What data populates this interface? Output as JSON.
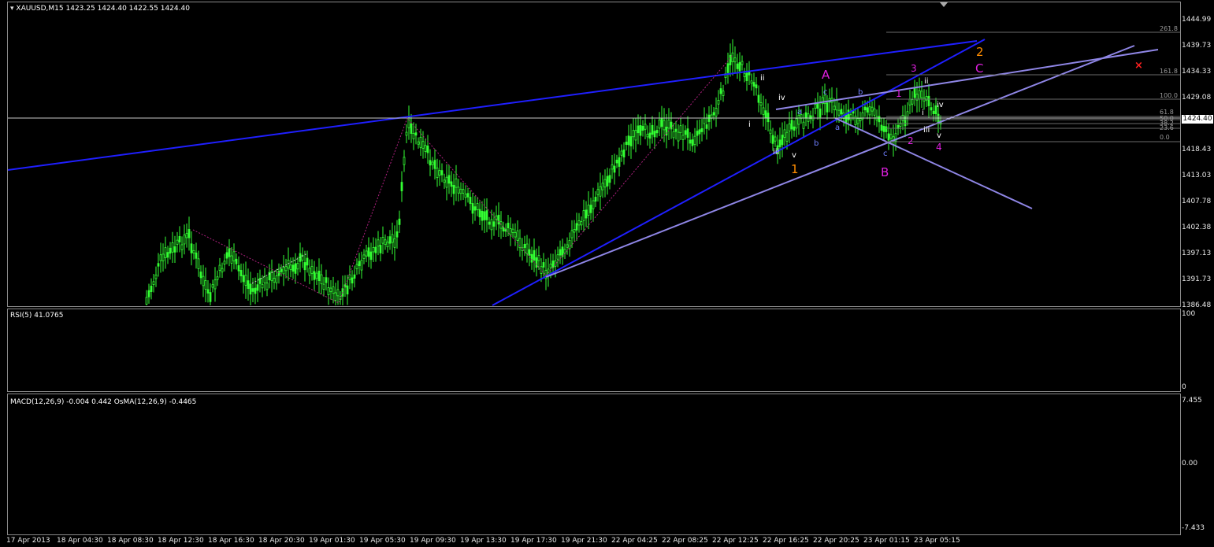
{
  "header": {
    "symbol": "XAUUSD,M15",
    "ohlc": "1423.25 1424.40 1422.55 1424.40"
  },
  "price_axis": {
    "ticks": [
      "1444.99",
      "1439.73",
      "1434.33",
      "1429.08",
      "1423.68",
      "1418.43",
      "1413.03",
      "1407.78",
      "1402.38",
      "1397.13",
      "1391.73",
      "1386.48"
    ],
    "current_price": "1424.40"
  },
  "rsi": {
    "label": "RSI(5) 41.0765",
    "ticks": [
      "100",
      "0"
    ]
  },
  "macd": {
    "label": "MACD(12,26,9) -0.004 0.442  OsMA(12,26,9) -0.4465",
    "ticks": [
      "7.455",
      "0.00",
      "-7.433"
    ]
  },
  "time_axis": [
    "17 Apr 2013",
    "18 Apr 04:30",
    "18 Apr 08:30",
    "18 Apr 12:30",
    "18 Apr 16:30",
    "18 Apr 20:30",
    "19 Apr 01:30",
    "19 Apr 05:30",
    "19 Apr 09:30",
    "19 Apr 13:30",
    "19 Apr 17:30",
    "19 Apr 21:30",
    "22 Apr 04:25",
    "22 Apr 08:25",
    "22 Apr 12:25",
    "22 Apr 16:25",
    "22 Apr 20:25",
    "23 Apr 01:15",
    "23 Apr 05:15"
  ],
  "fib_levels": [
    "261.8",
    "161.8",
    "100.0",
    "61.8",
    "50.0",
    "38.2",
    "23.6",
    "0.0"
  ],
  "wave_labels": [
    {
      "text": "A",
      "color": "#e020e0"
    },
    {
      "text": "B",
      "color": "#e020e0"
    },
    {
      "text": "C",
      "color": "#e020e0"
    },
    {
      "text": "1",
      "color": "#ff8c00"
    },
    {
      "text": "2",
      "color": "#ff8c00"
    },
    {
      "text": "3",
      "color": "#e020e0"
    },
    {
      "text": "4",
      "color": "#e020e0"
    },
    {
      "text": "2",
      "color": "#e020e0"
    },
    {
      "text": "1",
      "color": "#e020e0"
    },
    {
      "text": "ii",
      "color": "#ffffff"
    },
    {
      "text": "i",
      "color": "#ffffff"
    },
    {
      "text": "iii",
      "color": "#ffffff"
    },
    {
      "text": "iv",
      "color": "#ffffff"
    },
    {
      "text": "v",
      "color": "#ffffff"
    },
    {
      "text": "ii",
      "color": "#ffffff"
    },
    {
      "text": "iv",
      "color": "#ffffff"
    },
    {
      "text": "i",
      "color": "#ffffff"
    },
    {
      "text": "iii",
      "color": "#ffffff"
    },
    {
      "text": "v",
      "color": "#ffffff"
    },
    {
      "text": "a",
      "color": "#6f7fff"
    },
    {
      "text": "b",
      "color": "#6f7fff"
    },
    {
      "text": "c",
      "color": "#6f7fff"
    },
    {
      "text": "a",
      "color": "#6f7fff"
    },
    {
      "text": "b",
      "color": "#6f7fff"
    },
    {
      "text": "c",
      "color": "#6f7fff"
    }
  ],
  "marker": {
    "text": "×",
    "color": "#ff2020"
  },
  "colors": {
    "candle": "#33ff33",
    "rsi": "#ffff00",
    "trendline": "#1f1fff",
    "channel": "#8f86e6",
    "macd_hist": "#c0c0c0",
    "osma_hist": "#5a5ae6",
    "signal": "#ff2020"
  }
}
